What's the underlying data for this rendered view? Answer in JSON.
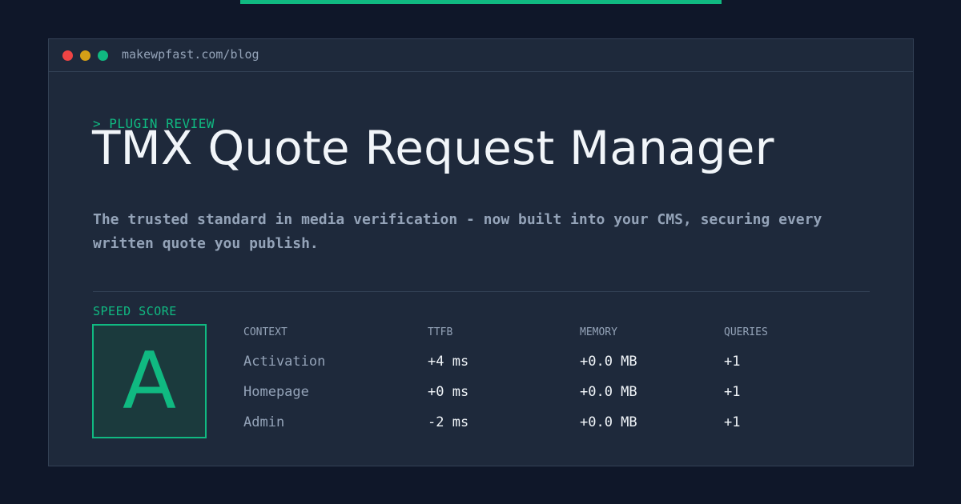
{
  "colors": {
    "accent": "#10b981",
    "background": "#0f1729",
    "panel": "#1e293b",
    "text": "#f1f5f9",
    "muted": "#94a3b8"
  },
  "window": {
    "controls": [
      "close-dot",
      "minimize-dot",
      "maximize-dot"
    ],
    "url": "makewpfast.com/blog"
  },
  "header": {
    "eyebrow": "> PLUGIN REVIEW",
    "title": "TMX Quote Request Manager",
    "description": "The trusted standard in media verification - now built into your CMS, securing every written quote you publish."
  },
  "speed": {
    "label": "SPEED SCORE",
    "grade": "A"
  },
  "metrics": {
    "columns": [
      "CONTEXT",
      "TTFB",
      "MEMORY",
      "QUERIES"
    ],
    "rows": [
      [
        "Activation",
        "+4 ms",
        "+0.0 MB",
        "+1"
      ],
      [
        "Homepage",
        "+0 ms",
        "+0.0 MB",
        "+1"
      ],
      [
        "Admin",
        "-2 ms",
        "+0.0 MB",
        "+1"
      ]
    ]
  }
}
